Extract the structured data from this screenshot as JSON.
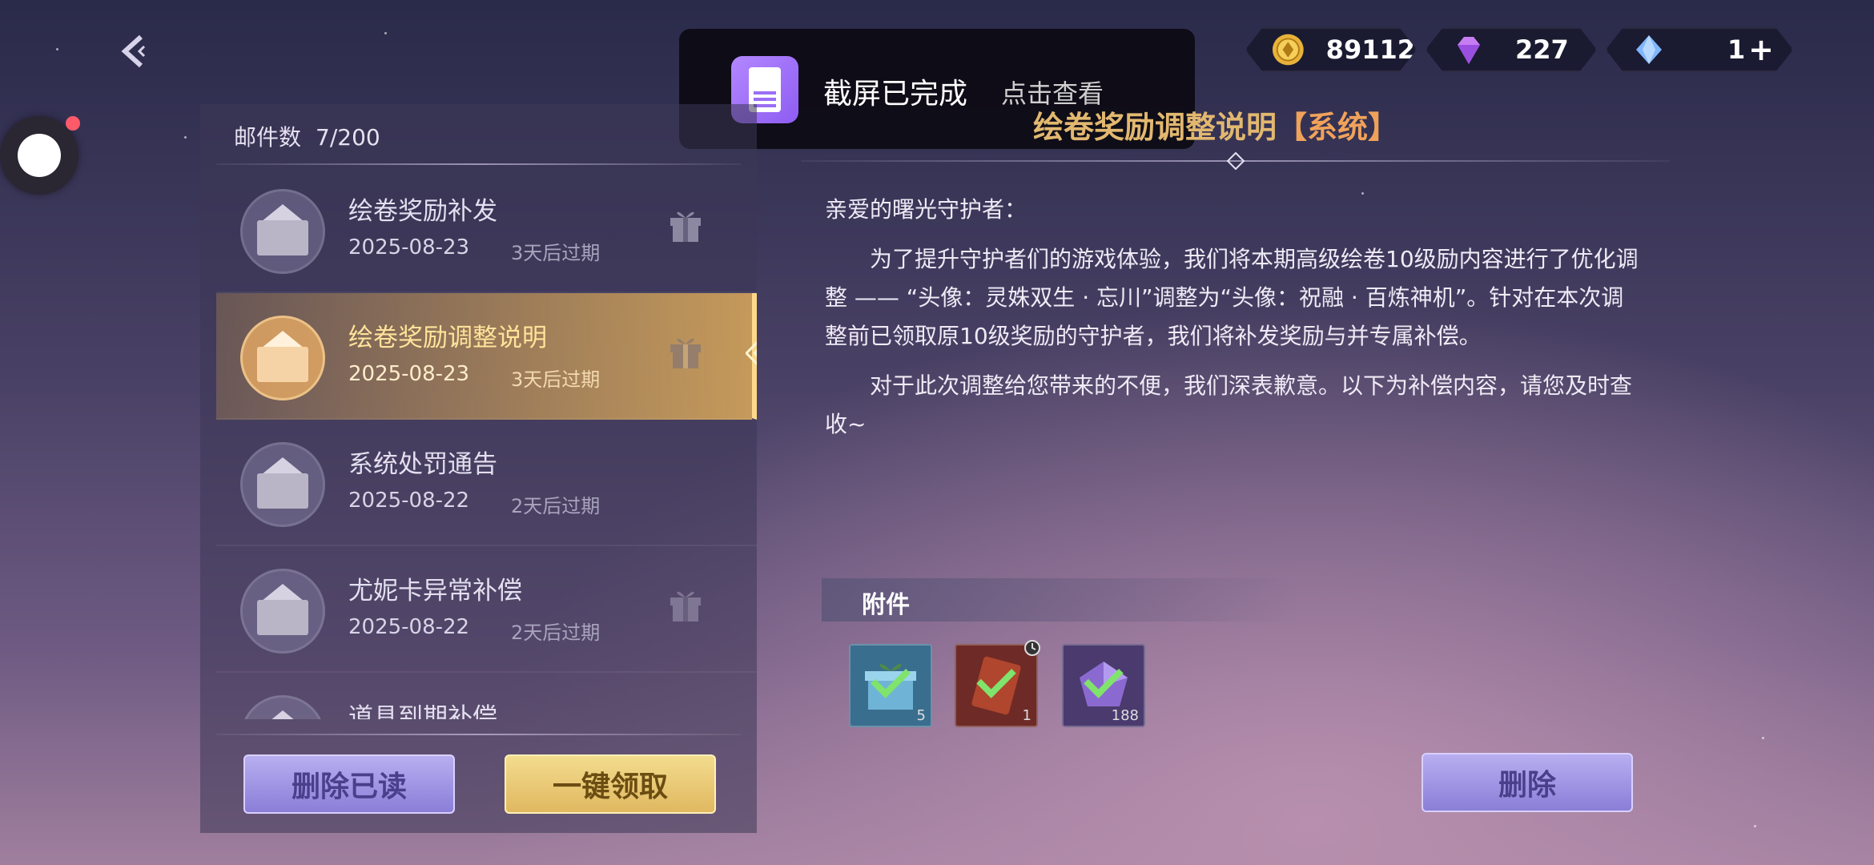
{
  "currency": {
    "gold": "89112",
    "gem": "227",
    "crystal": "1",
    "plus": "+"
  },
  "toast": {
    "message": "截屏已完成",
    "action": "点击查看"
  },
  "mail_list": {
    "count_label": "邮件数",
    "count_value": "7/200",
    "items": [
      {
        "title": "绘卷奖励补发",
        "date": "2025-08-23",
        "expiry": "3天后过期"
      },
      {
        "title": "绘卷奖励调整说明",
        "date": "2025-08-23",
        "expiry": "3天后过期"
      },
      {
        "title": "系统处罚通告",
        "date": "2025-08-22",
        "expiry": "2天后过期"
      },
      {
        "title": "尤妮卡异常补偿",
        "date": "2025-08-22",
        "expiry": "2天后过期"
      },
      {
        "title": "道具到期补偿",
        "date": "",
        "expiry": ""
      }
    ],
    "delete_read_label": "删除已读",
    "claim_all_label": "一键领取"
  },
  "mail_detail": {
    "title": "绘卷奖励调整说明",
    "badge": "【系统】",
    "greeting": "亲爱的曙光守护者：",
    "paragraph1": "　　为了提升守护者们的游戏体验，我们将本期高级绘卷10级励内容进行了优化调整 —— “头像：灵姝双生 · 忘川”调整为“头像：祝融 · 百炼神机”。针对在本次调整前已领取原10级奖励的守护者，我们将补发奖励与并专属补偿。",
    "paragraph2": "　　对于此次调整给您带来的不便，我们深表歉意。以下为补偿内容，请您及时查收~",
    "attachments_label": "附件",
    "attachments": [
      {
        "qty": "5",
        "color": "#3a6e8e"
      },
      {
        "qty": "1",
        "color": "#6e2a26"
      },
      {
        "qty": "188",
        "color": "#4a3a6e"
      }
    ],
    "delete_label": "删除"
  }
}
